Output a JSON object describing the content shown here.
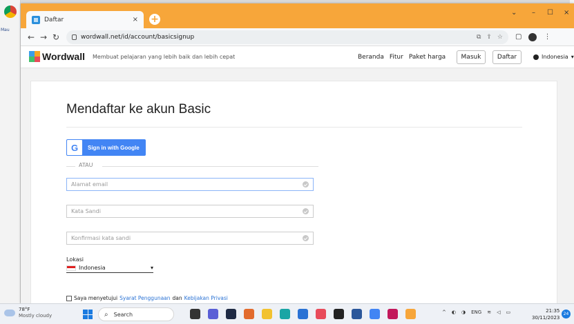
{
  "desktop": {
    "left_label": "Mau"
  },
  "browser": {
    "tab_title": "Daftar",
    "tab_close": "×",
    "new_tab": "+",
    "url": "wordwall.net/id/account/basicsignup",
    "win_min": "–",
    "win_max": "☐",
    "win_close": "×",
    "win_chevron": "⌄"
  },
  "site": {
    "logo_text": "Wordwall",
    "tagline": "Membuat pelajaran yang lebih baik dan lebih cepat",
    "nav": [
      "Beranda",
      "Fitur",
      "Paket harga"
    ],
    "login_label": "Masuk",
    "signup_label": "Daftar",
    "language": "Indonesia"
  },
  "form": {
    "title": "Mendaftar ke akun Basic",
    "google_label": "Sign in with Google",
    "or_label": "ATAU",
    "email_placeholder": "Alamat email",
    "password_placeholder": "Kata Sandi",
    "confirm_placeholder": "Konfirmasi kata sandi",
    "location_label": "Lokasi",
    "location_value": "Indonesia",
    "agree_text": "Saya menyetujui",
    "terms_link": "Syarat Penggunaan",
    "and_text": "dan",
    "privacy_link": "Kebijakan Privasi"
  },
  "taskbar": {
    "temp": "78°F",
    "weather": "Mostly cloudy",
    "search_label": "Search",
    "lang": "ENG",
    "time": "21:35",
    "date": "30/11/2023",
    "notif_count": "24"
  },
  "colors": {
    "titlebar": "#f7a63a",
    "google_blue": "#4285f4",
    "link": "#2a72d4"
  }
}
